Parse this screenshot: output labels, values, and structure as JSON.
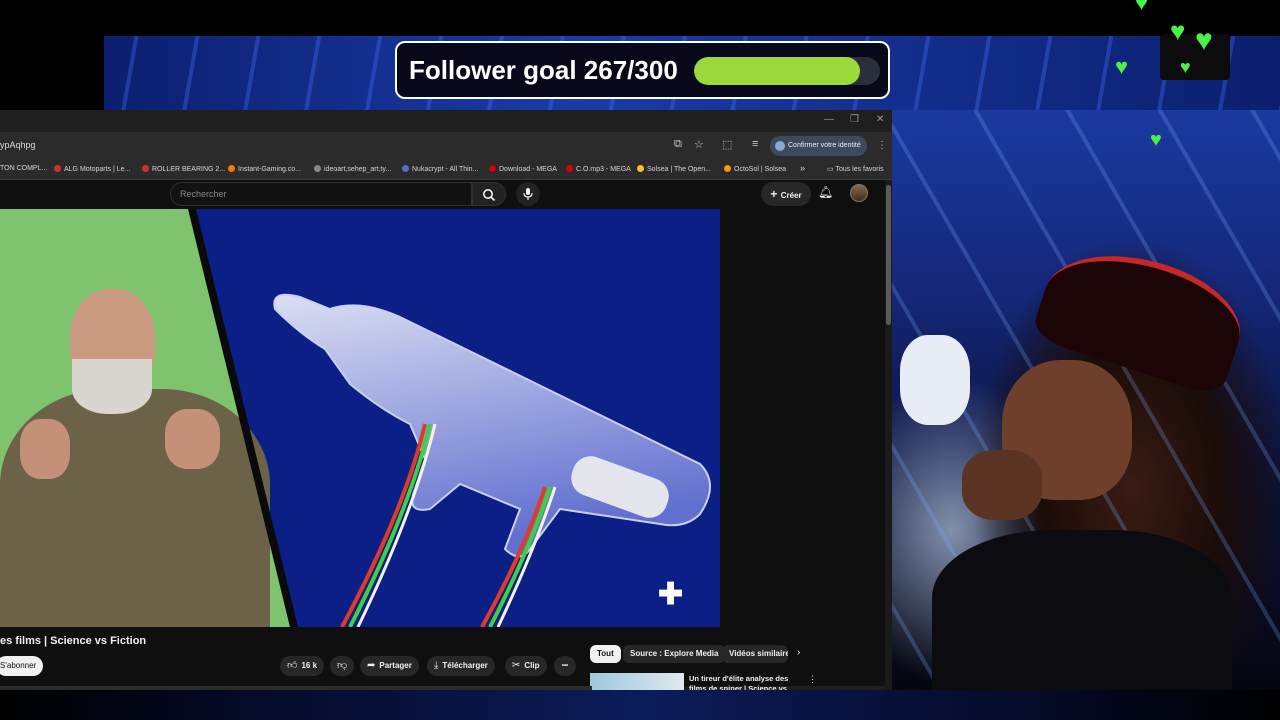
{
  "overlay": {
    "goal_text": "Follower goal 267/300",
    "goal_current": 267,
    "goal_target": 300,
    "goal_fill_color": "#9bd93a",
    "heart_color": "#4cf04a"
  },
  "browser": {
    "url_fragment": "ypAqhpg",
    "confirm_identity": "Confirmer votre identité",
    "bookmarks": [
      "TON COMPL...",
      "ALG Motoparts | Le...",
      "ROLLER BEARING 2...",
      "Instant-Gaming.co...",
      "ideoart,sehep_art,ty...",
      "Nukacrypt - All Thin...",
      "Download - MEGA",
      "C.O.mp3 - MEGA",
      "Solsea | The Open...",
      "OctoSol | Solsea",
      "Tous les favoris"
    ],
    "bookmark_more": "»"
  },
  "youtube": {
    "search_placeholder": "Rechercher",
    "create_label": "Créer",
    "video_title": "es films | Science vs Fiction",
    "subscribe_label": "S'abonner",
    "likes": "16 k",
    "share_label": "Partager",
    "download_label": "Télécharger",
    "clip_label": "Clip",
    "more_label": "•••",
    "chips": [
      "Tout",
      "Source : Explore Media",
      "Vidéos similaire"
    ],
    "recommendation_title": "Un tireur d'élite analyse des films de sniper | Science vs",
    "plus_symbol": "✚"
  }
}
